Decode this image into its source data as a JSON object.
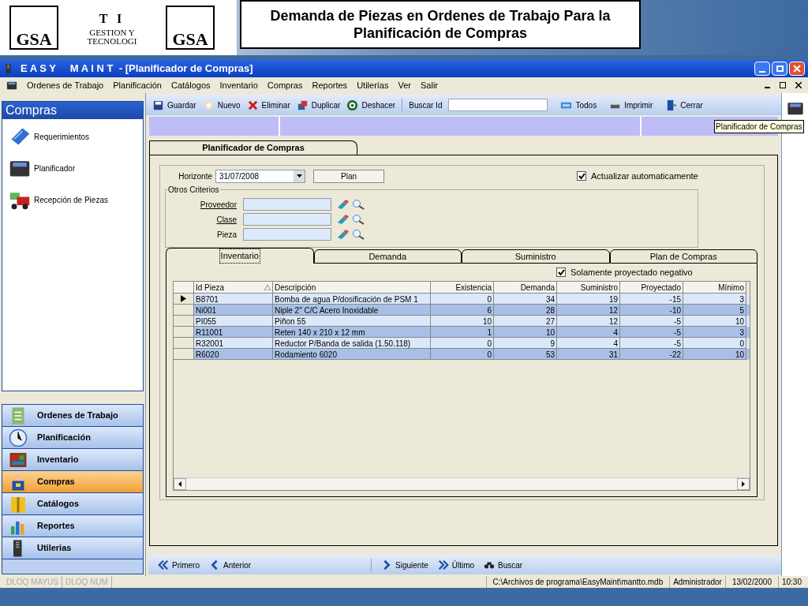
{
  "slide": {
    "logo_left": "GSA",
    "logo_mid_top": "T I",
    "logo_mid_bottom": "GESTION Y TECNOLOGI",
    "logo_right": "GSA",
    "title": "Demanda de Piezas en Ordenes de Trabajo Para la Planificación de Compras"
  },
  "window": {
    "title": "E A S Y     M A I N T  - [Planificador de Compras]"
  },
  "menu": [
    "Ordenes de Trabajo",
    "Planificación",
    "Catálogos",
    "Inventario",
    "Compras",
    "Reportes",
    "Utilerías",
    "Ver",
    "Salir"
  ],
  "toolbar": {
    "items": [
      {
        "kind": "save",
        "label": "Guardar"
      },
      {
        "kind": "new",
        "label": "Nuevo"
      },
      {
        "kind": "delete",
        "label": "Eliminar"
      },
      {
        "kind": "duplicate",
        "label": "Duplicar"
      },
      {
        "kind": "undo",
        "label": "Deshacer"
      }
    ],
    "search_label": "Buscar Id",
    "right_items": [
      {
        "kind": "all",
        "label": "Todos"
      },
      {
        "kind": "print",
        "label": "Imprimir"
      },
      {
        "kind": "close",
        "label": "Cerrar"
      }
    ]
  },
  "sidebar": {
    "header": "Compras",
    "items": [
      {
        "kind": "requests",
        "label": "Requerimientos"
      },
      {
        "kind": "calculator",
        "label": "Planificador"
      },
      {
        "kind": "truck",
        "label": "Recepción de Piezas"
      }
    ],
    "groups": [
      {
        "kind": "orders",
        "label": "Ordenes de Trabajo",
        "selected": false
      },
      {
        "kind": "clock",
        "label": "Planificación",
        "selected": false
      },
      {
        "kind": "shelf",
        "label": "Inventario",
        "selected": false
      },
      {
        "kind": "buyer",
        "label": "Compras",
        "selected": true
      },
      {
        "kind": "folder",
        "label": "Catálogos",
        "selected": false
      },
      {
        "kind": "chart",
        "label": "Reportes",
        "selected": false
      },
      {
        "kind": "tools",
        "label": "Utilerias",
        "selected": false
      }
    ]
  },
  "tooltip": "Planificador de Compras",
  "form": {
    "tab": "Planificador de Compras",
    "horizon_label": "Horizonte",
    "horizon_value": "31/07/2008",
    "plan_button": "Plan",
    "auto_update": {
      "label": "Actualizar automaticamente",
      "checked": true
    },
    "criteria": {
      "title": "Otros Criterios",
      "fields": [
        {
          "label": "Proveedor",
          "underlined": true
        },
        {
          "label": "Clase",
          "underlined": true
        },
        {
          "label": "Pieza",
          "underlined": false
        }
      ]
    },
    "tabs": [
      {
        "label": "Inventario",
        "selected": true
      },
      {
        "label": "Demanda",
        "selected": false
      },
      {
        "label": "Suministro",
        "selected": false
      },
      {
        "label": "Plan de Compras",
        "selected": false
      }
    ],
    "negative_only": {
      "label": "Solamente proyectado negativo",
      "checked": true
    },
    "table": {
      "columns": [
        {
          "label": "Id Pieza",
          "sorted": true,
          "kind": "text"
        },
        {
          "label": "Descripción",
          "sorted": false,
          "kind": "text"
        },
        {
          "label": "Existencia",
          "sorted": false,
          "kind": "number"
        },
        {
          "label": "Demanda",
          "sorted": false,
          "kind": "number"
        },
        {
          "label": "Suministro",
          "sorted": false,
          "kind": "number"
        },
        {
          "label": "Proyectado",
          "sorted": false,
          "kind": "number"
        },
        {
          "label": "Mínimo",
          "sorted": false,
          "kind": "number"
        }
      ],
      "rows": [
        {
          "current": true,
          "cells": [
            "B8701",
            "Bomba de agua P/dosificación de PSM 1",
            "0",
            "34",
            "19",
            "-15",
            "3"
          ]
        },
        {
          "current": false,
          "cells": [
            "Ni001",
            "Niple 2\" C/C Acero Inoxidable",
            "6",
            "28",
            "12",
            "-10",
            "5"
          ]
        },
        {
          "current": false,
          "cells": [
            "PI055",
            "Piñon 55",
            "10",
            "27",
            "12",
            "-5",
            "10"
          ]
        },
        {
          "current": false,
          "cells": [
            "R11001",
            "Reten 140 x 210 x 12 mm",
            "1",
            "10",
            "4",
            "-5",
            "3"
          ]
        },
        {
          "current": false,
          "cells": [
            "R32001",
            "Reductor P/Banda de salida (1.50.118)",
            "0",
            "9",
            "4",
            "-5",
            "0"
          ]
        },
        {
          "current": false,
          "cells": [
            "R6020",
            "Rodamiento 6020",
            "0",
            "53",
            "31",
            "-22",
            "10"
          ]
        }
      ]
    }
  },
  "nav": {
    "left": [
      {
        "kind": "first",
        "label": "Primero"
      },
      {
        "kind": "prev",
        "label": "Anterior"
      }
    ],
    "right": [
      {
        "kind": "next",
        "label": "Siguiente"
      },
      {
        "kind": "last",
        "label": "Último"
      },
      {
        "kind": "find",
        "label": "Buscar"
      }
    ]
  },
  "status_bar": {
    "keys": [
      {
        "label": "DLOQ MAYUS",
        "disabled": true
      },
      {
        "label": "DLOQ NUM",
        "disabled": true
      }
    ],
    "path": "C:\\Archivos de programa\\EasyMaint\\mantto.mdb",
    "user": "Administrador",
    "date": "13/02/2000",
    "time": "10:30"
  }
}
